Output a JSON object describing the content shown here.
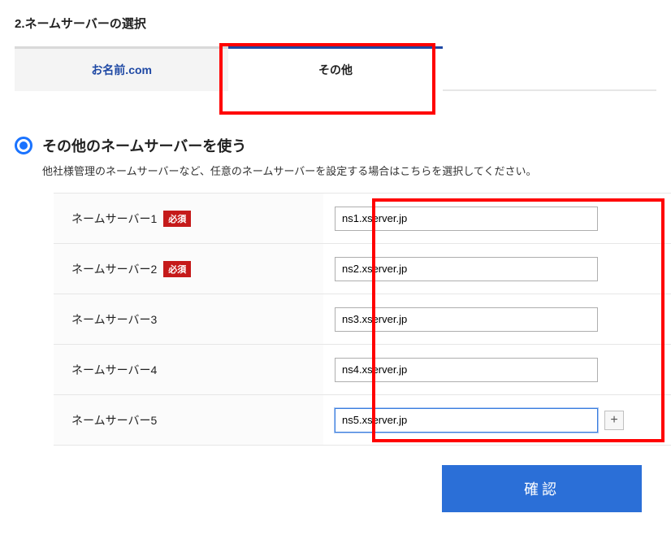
{
  "section_title": "2.ネームサーバーの選択",
  "tabs": {
    "onamae": "お名前.com",
    "other": "その他"
  },
  "option": {
    "title": "その他のネームサーバーを使う",
    "desc": "他社様管理のネームサーバーなど、任意のネームサーバーを設定する場合はこちらを選択してください。"
  },
  "req": "必須",
  "ns_labels": {
    "1": "ネームサーバー1",
    "2": "ネームサーバー2",
    "3": "ネームサーバー3",
    "4": "ネームサーバー4",
    "5": "ネームサーバー5"
  },
  "ns_values": {
    "1": "ns1.xserver.jp",
    "2": "ns2.xserver.jp",
    "3": "ns3.xserver.jp",
    "4": "ns4.xserver.jp",
    "5": "ns5.xserver.jp"
  },
  "plus": "+",
  "confirm": "確認"
}
